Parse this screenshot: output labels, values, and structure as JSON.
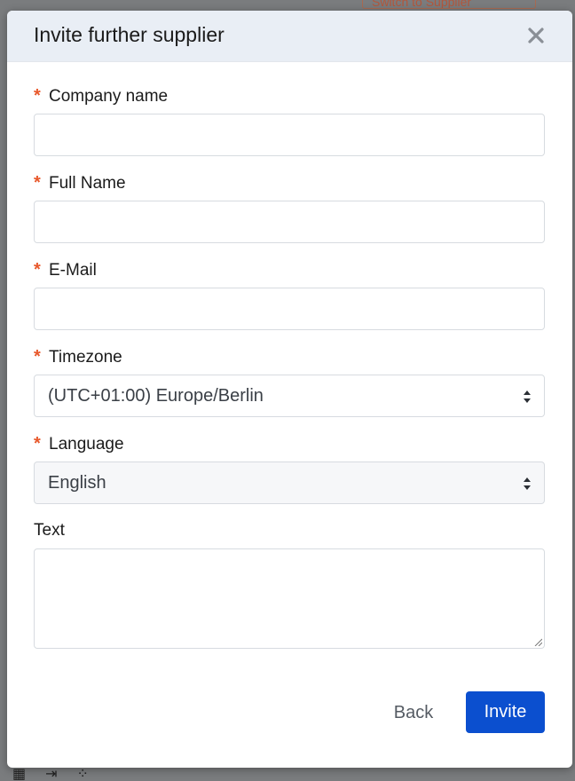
{
  "background": {
    "switch_label": "Switch to Supplier"
  },
  "modal": {
    "title": "Invite further supplier",
    "close_icon": "close-icon",
    "fields": {
      "company_name": {
        "label": "Company name",
        "required": "*",
        "value": "",
        "placeholder": ""
      },
      "full_name": {
        "label": "Full Name",
        "required": "*",
        "value": "",
        "placeholder": ""
      },
      "email": {
        "label": "E-Mail",
        "required": "*",
        "value": "",
        "placeholder": ""
      },
      "timezone": {
        "label": "Timezone",
        "required": "*",
        "value": "(UTC+01:00) Europe/Berlin"
      },
      "language": {
        "label": "Language",
        "required": "*",
        "value": "English"
      },
      "text": {
        "label": "Text",
        "value": ""
      }
    },
    "footer": {
      "back_label": "Back",
      "invite_label": "Invite"
    }
  },
  "colors": {
    "accent": "#0b4fcf",
    "required": "#e8582b",
    "header_bg": "#e9eef5"
  }
}
